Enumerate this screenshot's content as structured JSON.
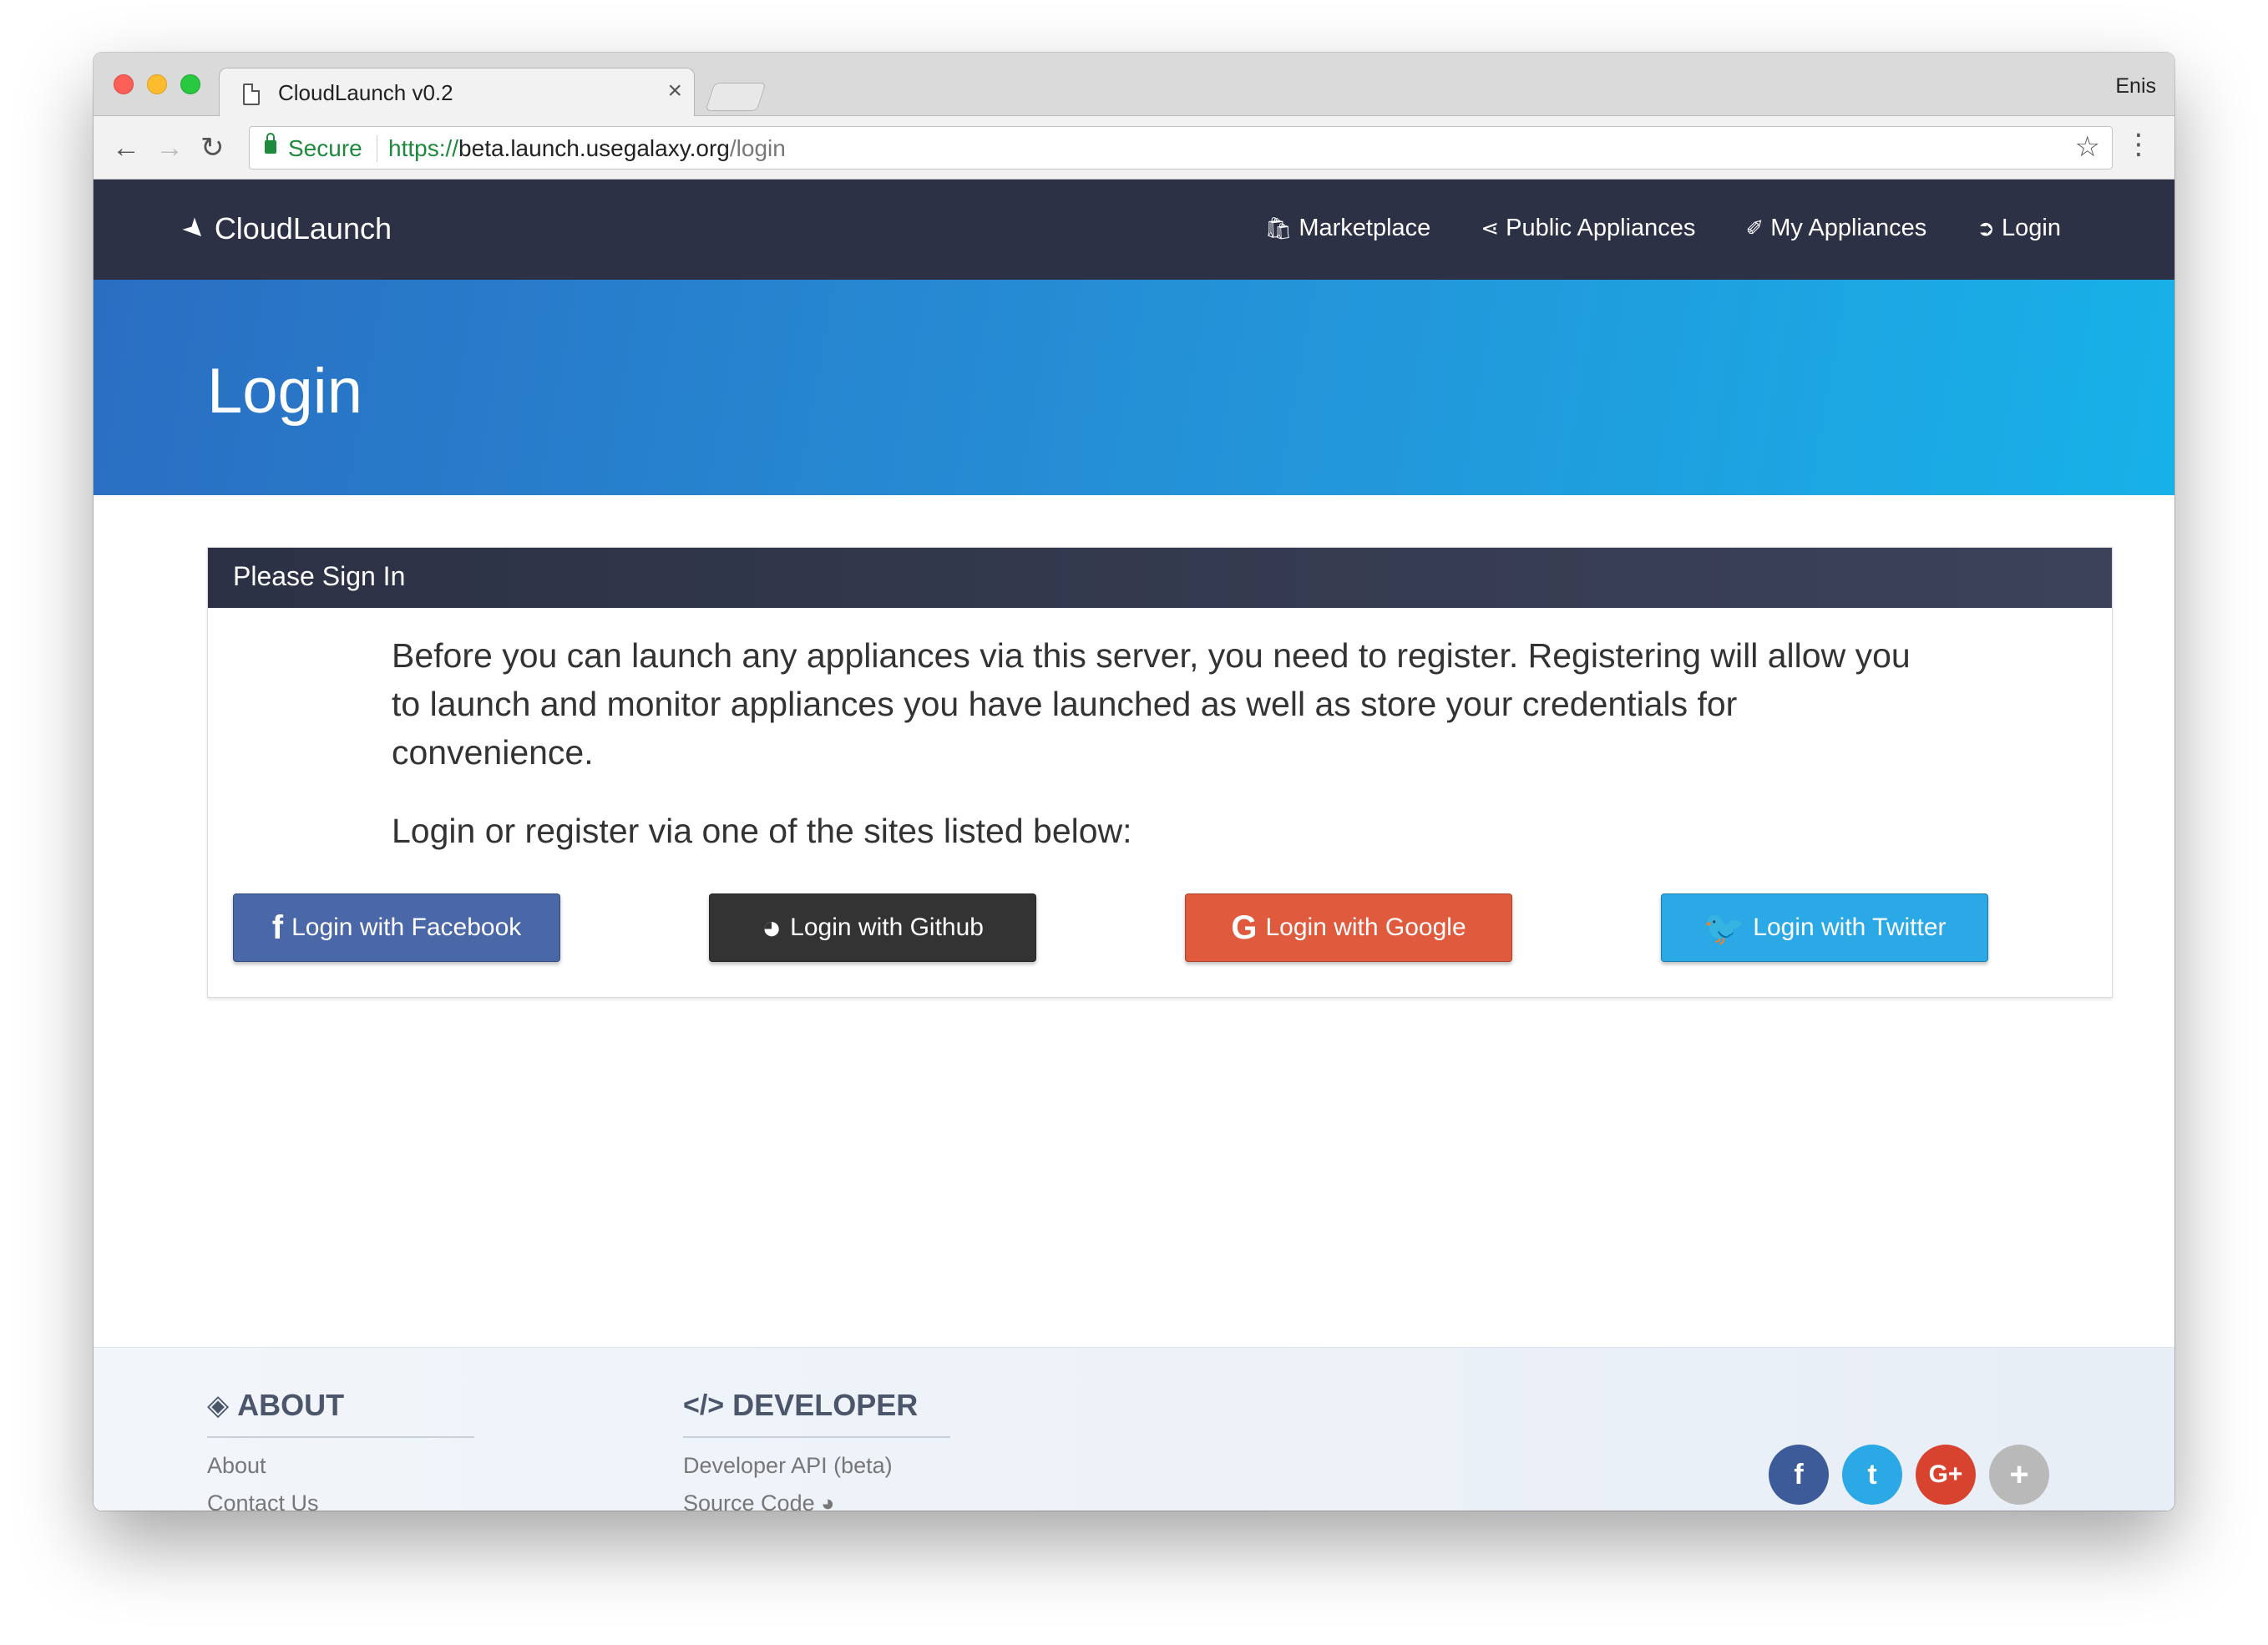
{
  "browser": {
    "tab_title": "CloudLaunch v0.2",
    "tab_close": "×",
    "profile": "Enis",
    "secure_label": "Secure",
    "url_scheme": "https://",
    "url_host": "beta.launch.usegalaxy.org",
    "url_path": "/login",
    "back_icon": "←",
    "forward_icon": "→",
    "reload_icon": "↻",
    "star_icon": "☆",
    "menu_icon": "⋮"
  },
  "navbar": {
    "brand": "CloudLaunch",
    "items": [
      {
        "label": "Marketplace",
        "icon": "🛍"
      },
      {
        "label": "Public Appliances",
        "icon": "⋖"
      },
      {
        "label": "My Appliances",
        "icon": "✐"
      },
      {
        "label": "Login",
        "icon": "➲"
      }
    ]
  },
  "hero": {
    "title": "Login"
  },
  "panel": {
    "heading": "Please Sign In",
    "intro": "Before you can launch any appliances via this server, you need to register. Registering will allow you to launch and monitor appliances you have launched as well as store your credentials for convenience.",
    "instruction": "Login or register via one of the sites listed below:",
    "buttons": {
      "facebook": {
        "label": "Login with Facebook",
        "icon": "f",
        "color": "#4a68a8"
      },
      "github": {
        "label": "Login with Github",
        "icon": "◕",
        "color": "#333333"
      },
      "google": {
        "label": "Login with Google",
        "icon": "G",
        "color": "#e05a3d"
      },
      "twitter": {
        "label": "Login with Twitter",
        "icon": "🐦",
        "color": "#2aa9e6"
      }
    }
  },
  "footer": {
    "about": {
      "heading": "ABOUT",
      "links": [
        "About",
        "Contact Us"
      ]
    },
    "developer": {
      "heading": "DEVELOPER",
      "icon": "</>",
      "links": [
        "Developer API (beta)",
        "Source Code"
      ]
    },
    "social": [
      "f",
      "t",
      "G+",
      "+"
    ]
  },
  "colors": {
    "navbar": "#2c3145",
    "hero_start": "#2a6ec2",
    "hero_end": "#17b1e8",
    "secure_green": "#1d8a3c"
  }
}
